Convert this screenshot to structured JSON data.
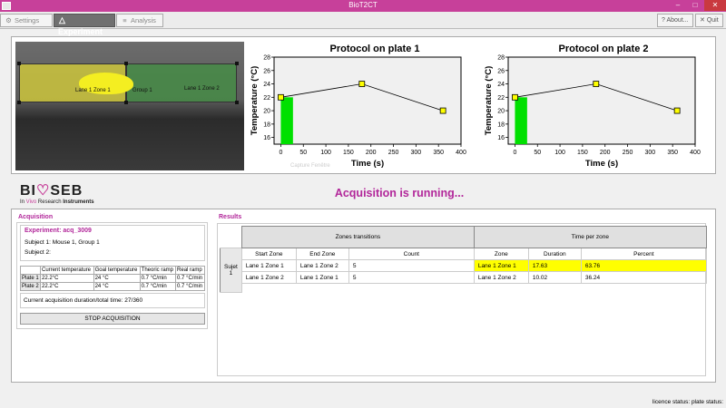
{
  "window": {
    "title": "BioT2CT",
    "minimize": "–",
    "maximize": "□",
    "close": "✕"
  },
  "tabs": [
    {
      "label": "Settings",
      "icon": "gear-icon",
      "glyph": "⚙"
    },
    {
      "label": "Experiment",
      "icon": "triangle-icon",
      "glyph": "△"
    },
    {
      "label": "Analysis",
      "icon": "chart-icon",
      "glyph": "≡"
    }
  ],
  "toolbar_right": {
    "about_label": "About...",
    "about_glyph": "?",
    "quit_label": "Quit",
    "quit_glyph": "✕"
  },
  "camera": {
    "zone1_label": "Lane 1 Zone 1",
    "group_label": "Group 1",
    "zone2_label": "Lane 1 Zone 2"
  },
  "ghost_text": "Capture Fenêtre",
  "chart_data": [
    {
      "type": "line",
      "title": "Protocol on plate 1",
      "xlabel": "Time (s)",
      "ylabel": "Temperature (°C)",
      "xlim": [
        -15,
        400
      ],
      "ylim": [
        15,
        28
      ],
      "xticks": [
        0,
        50,
        100,
        150,
        200,
        250,
        300,
        350,
        400
      ],
      "yticks": [
        16,
        18,
        20,
        22,
        24,
        26,
        28
      ],
      "x": [
        0,
        180,
        360
      ],
      "y": [
        22,
        24,
        20
      ],
      "progress_fill": {
        "x_start": 0,
        "x_end": 27,
        "color": "#00e000"
      },
      "marker_color": "#ffff00",
      "grid": false
    },
    {
      "type": "line",
      "title": "Protocol on plate 2",
      "xlabel": "Time (s)",
      "ylabel": "Temperature (°C)",
      "xlim": [
        -15,
        400
      ],
      "ylim": [
        15,
        28
      ],
      "xticks": [
        0,
        50,
        100,
        150,
        200,
        250,
        300,
        350,
        400
      ],
      "yticks": [
        16,
        18,
        20,
        22,
        24,
        26,
        28
      ],
      "x": [
        0,
        180,
        360
      ],
      "y": [
        22,
        24,
        20
      ],
      "progress_fill": {
        "x_start": 0,
        "x_end": 27,
        "color": "#00e000"
      },
      "marker_color": "#ffff00",
      "grid": false
    }
  ],
  "logo": {
    "brand_pre": "BI",
    "brand_post": "SEB",
    "tag_pre": "In ",
    "tag_vivo": "Vivo",
    "tag_post": " Research ",
    "tag_bold": "Instruments"
  },
  "status_message": "Acquisition is running...",
  "acquisition": {
    "section_title": "Acquisition",
    "experiment_label": "Experiment: acq_3009",
    "subject1": "Subject 1:  Mouse 1, Group 1",
    "subject2": "Subject 2:",
    "plate_table": {
      "headers": [
        "",
        "Current temperature",
        "Goal temperature",
        "Theoric ramp",
        "Real ramp"
      ],
      "rows": [
        [
          "Plate 1",
          "22.2°C",
          "24 °C",
          "0.7 °C/min",
          "0.7 °C/min"
        ],
        [
          "Plate 2",
          "22.2°C",
          "24 °C",
          "0.7 °C/min",
          "0.7 °C/min"
        ]
      ]
    },
    "duration_label": "Current acquisition duration/total time:  27/360",
    "stop_button": "STOP ACQUISITION"
  },
  "results": {
    "section_title": "Results",
    "group1_header": "Zones transitions",
    "group2_header": "Time per zone",
    "columns": [
      "Start Zone",
      "End Zone",
      "Count",
      "Zone",
      "Duration",
      "Percent"
    ],
    "subject_label": "Sujet 1",
    "rows": [
      {
        "start": "Lane 1 Zone 1",
        "end": "Lane 1 Zone 2",
        "count": "5",
        "zone": "Lane 1 Zone 1",
        "duration": "17.63",
        "percent": "63.76",
        "highlight": true
      },
      {
        "start": "Lane 1 Zone 2",
        "end": "Lane 1 Zone 1",
        "count": "5",
        "zone": "Lane 1 Zone 2",
        "duration": "10.02",
        "percent": "36.24",
        "highlight": false
      }
    ],
    "highlight_color": "#ffff00"
  },
  "statusbar": {
    "text": "licence status:  plate status:"
  }
}
